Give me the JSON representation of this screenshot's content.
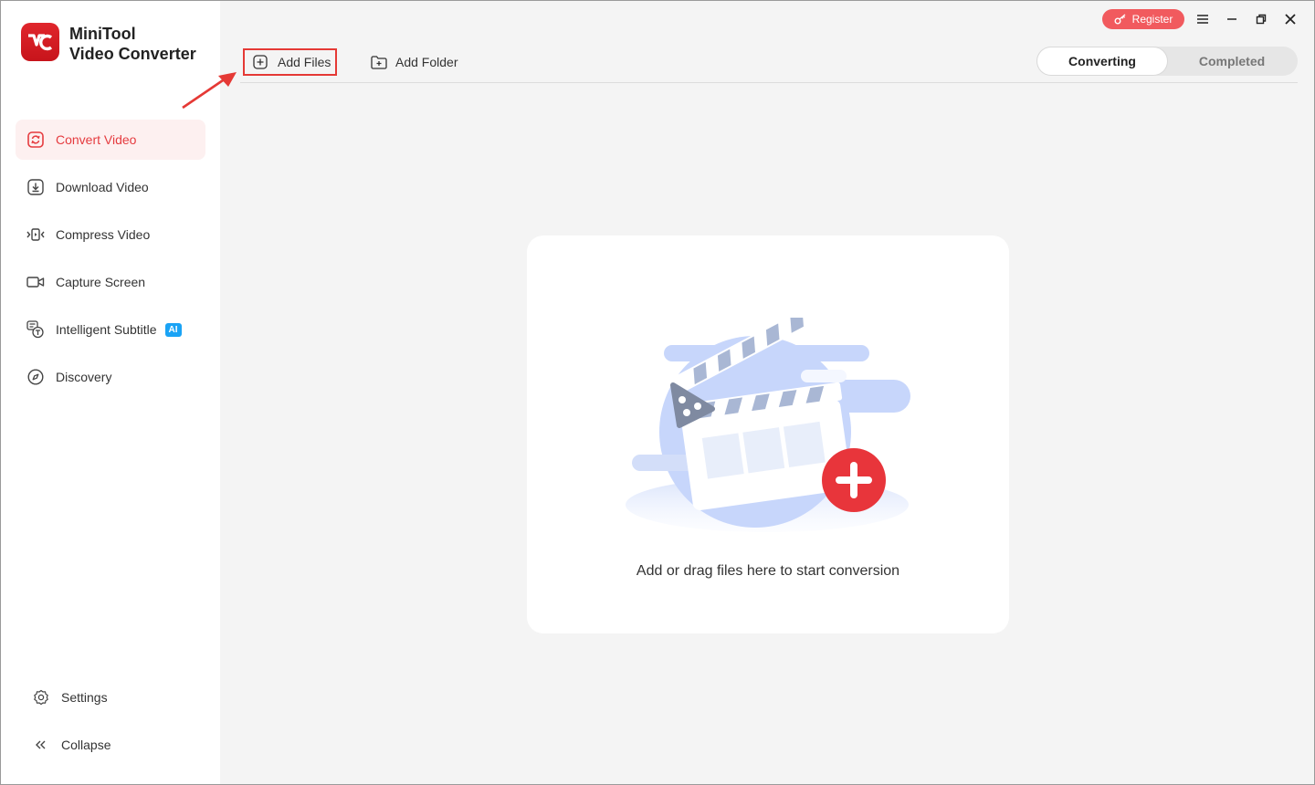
{
  "app": {
    "name_line1": "MiniTool",
    "name_line2": "Video Converter",
    "logo_text": "VC"
  },
  "sidebar": {
    "items": [
      {
        "label": "Convert Video",
        "icon": "convert-icon",
        "active": true
      },
      {
        "label": "Download Video",
        "icon": "download-icon",
        "active": false
      },
      {
        "label": "Compress Video",
        "icon": "compress-icon",
        "active": false
      },
      {
        "label": "Capture Screen",
        "icon": "camera-icon",
        "active": false
      },
      {
        "label": "Intelligent Subtitle",
        "icon": "subtitle-icon",
        "active": false,
        "badge": "AI"
      },
      {
        "label": "Discovery",
        "icon": "compass-icon",
        "active": false
      }
    ],
    "settings_label": "Settings",
    "collapse_label": "Collapse"
  },
  "toolbar": {
    "add_files_label": "Add Files",
    "add_folder_label": "Add Folder"
  },
  "tabs": [
    {
      "label": "Converting",
      "active": true
    },
    {
      "label": "Completed",
      "active": false
    }
  ],
  "titlebar": {
    "register_label": "Register"
  },
  "dropzone": {
    "text": "Add or drag files here to start conversion"
  },
  "colors": {
    "accent": "#e53b3f",
    "brand_red": "#d61c22",
    "ai_badge": "#1aa3f5",
    "register": "#f15a5e"
  }
}
